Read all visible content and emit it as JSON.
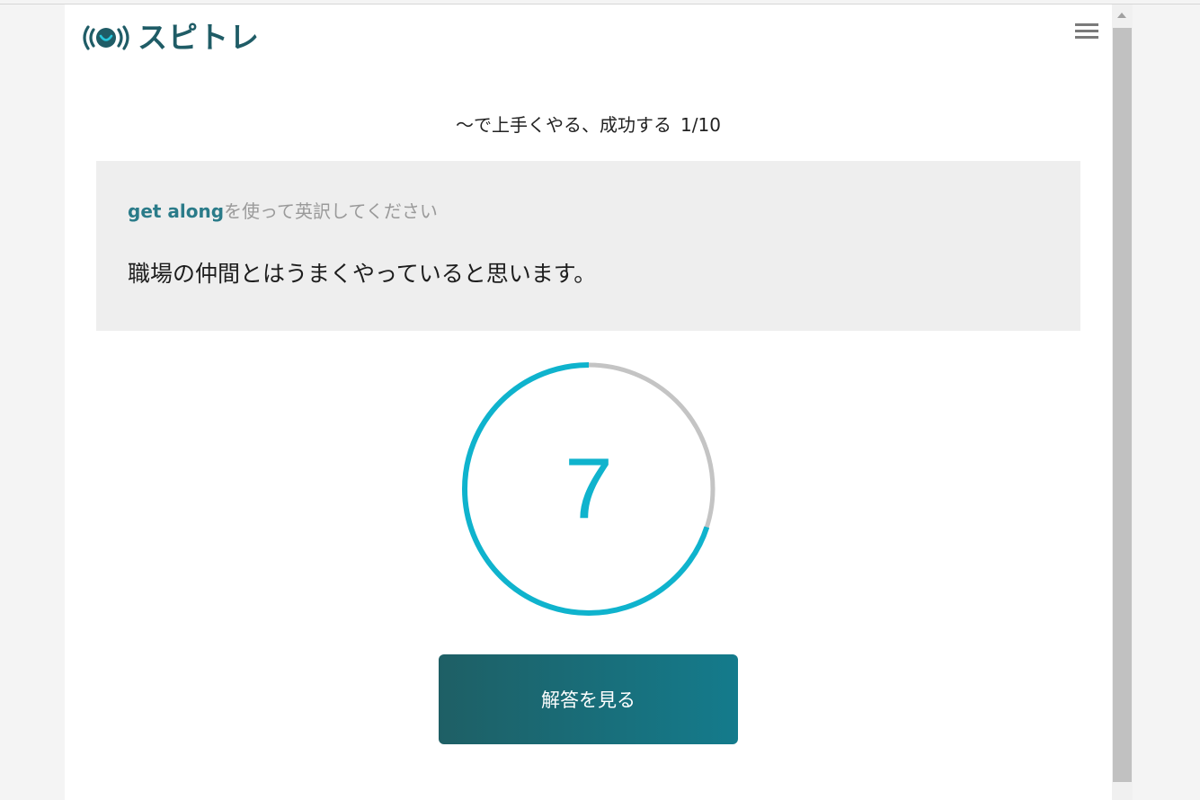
{
  "app": {
    "logo_text": "スピトレ",
    "brand_color": "#1f5c66",
    "accent_color": "#0fb3cd"
  },
  "header": {
    "menu_icon": "hamburger-menu-icon"
  },
  "quiz": {
    "title": "～で上手くやる、成功する",
    "counter": "1/10"
  },
  "question": {
    "keyword": "get along",
    "instruction_suffix": "を使って英訳してください",
    "prompt": "職場の仲間とはうまくやっていると思います。"
  },
  "timer": {
    "remaining": "7",
    "progress_fraction": 0.7
  },
  "actions": {
    "show_answer_label": "解答を見る"
  }
}
